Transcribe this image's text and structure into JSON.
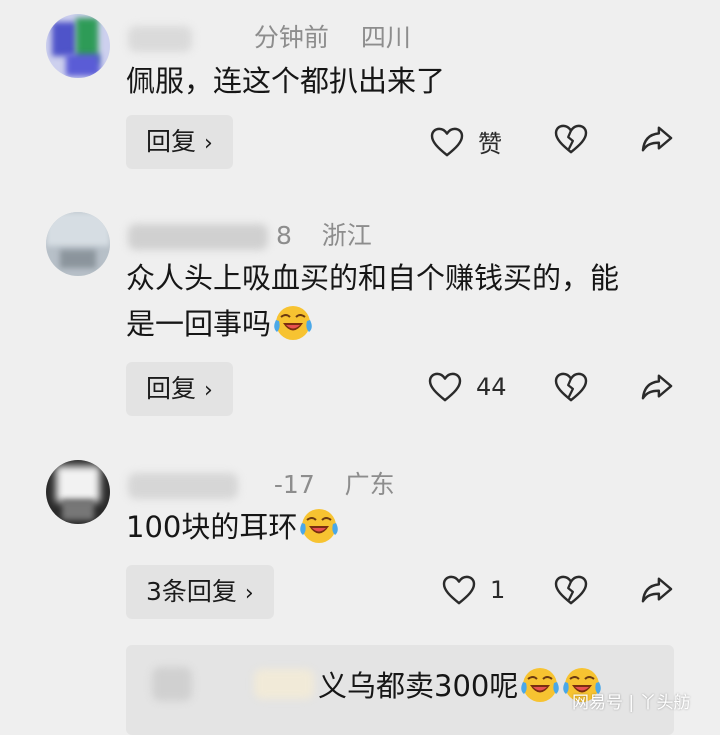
{
  "comments": [
    {
      "time": "分钟前",
      "location": "四川",
      "text": "佩服，连这个都扒出来了",
      "reply_label": "回复",
      "like_label": "赞"
    },
    {
      "time": "8",
      "location": "浙江",
      "text_line1": "众人头上吸血买的和自个赚钱买的，能",
      "text_line2": "是一回事吗",
      "emoji": "laughing-crying-emoji",
      "reply_label": "回复",
      "like_count": "44"
    },
    {
      "time": "-17",
      "location": "广东",
      "text": "100块的耳环",
      "emoji": "laughing-crying-emoji",
      "reply_label": "3条回复",
      "like_count": "1"
    }
  ],
  "quoted_reply": {
    "text": "义乌都卖300呢",
    "emoji": "laughing-crying-emoji"
  },
  "watermark": "网易号 | 丫头舫",
  "icons": [
    "heart-outline-icon",
    "broken-heart-icon",
    "share-arrow-icon",
    "chevron-right-icon"
  ],
  "colors": {
    "background": "#efefef",
    "reply_button": "#e3e3e3",
    "meta_text": "#8d8d8d",
    "emoji_yellow": "#f7c331"
  }
}
